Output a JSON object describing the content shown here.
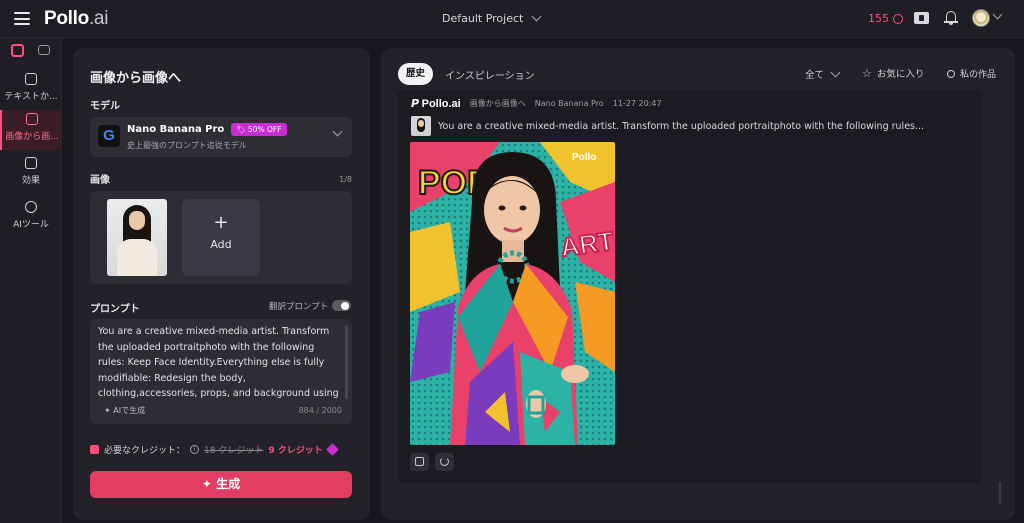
{
  "header": {
    "logo_main": "Pollo",
    "logo_suffix": ".ai",
    "project": "Default Project",
    "credits": "155"
  },
  "leftnav": {
    "items": [
      {
        "label": "テキストか..."
      },
      {
        "label": "画像から画..."
      },
      {
        "label": "効果"
      },
      {
        "label": "AIツール"
      }
    ]
  },
  "panel": {
    "title": "画像から画像へ",
    "model_label": "モデル",
    "model_name": "Nano Banana Pro",
    "model_badge": "50% OFF",
    "model_desc": "史上最強のプロンプト追従モデル",
    "image_label": "画像",
    "image_count": "1/8",
    "add_label": "Add",
    "prompt_label": "プロンプト",
    "translate_label": "翻訳プロンプト",
    "prompt_text": "You are a creative mixed-media artist. Transform the uploaded portraitphoto with the following rules: Keep Face Identity.Everything else is fully modifiable: Redesign the body, clothing,accessories, props, and background using",
    "ai_generate": "AIで生成",
    "char_count": "884 / 2000",
    "credits_label": "必要なクレジット：",
    "credits_old": "18 クレジット",
    "credits_new": "9 クレジット",
    "generate_button": "生成"
  },
  "rpanel": {
    "tab_history": "歴史",
    "tab_inspiration": "インスピレーション",
    "filter_all": "全て",
    "favorites": "お気に入り",
    "my_works": "私の作品",
    "card": {
      "brand_p": "P",
      "brand": "Pollo.ai",
      "mode": "画像から画像へ",
      "model": "Nano Banana Pro",
      "date": "11-27 20:47",
      "prompt": "You are a creative mixed-media artist. Transform the uploaded portraitphoto with the following rules...",
      "art_pop": "POP",
      "art_art": "ART",
      "art_logo": "Pollo"
    }
  },
  "colors": {
    "accent": "#e23d63",
    "badge": "#c92bd4",
    "bg": "#17171c"
  }
}
